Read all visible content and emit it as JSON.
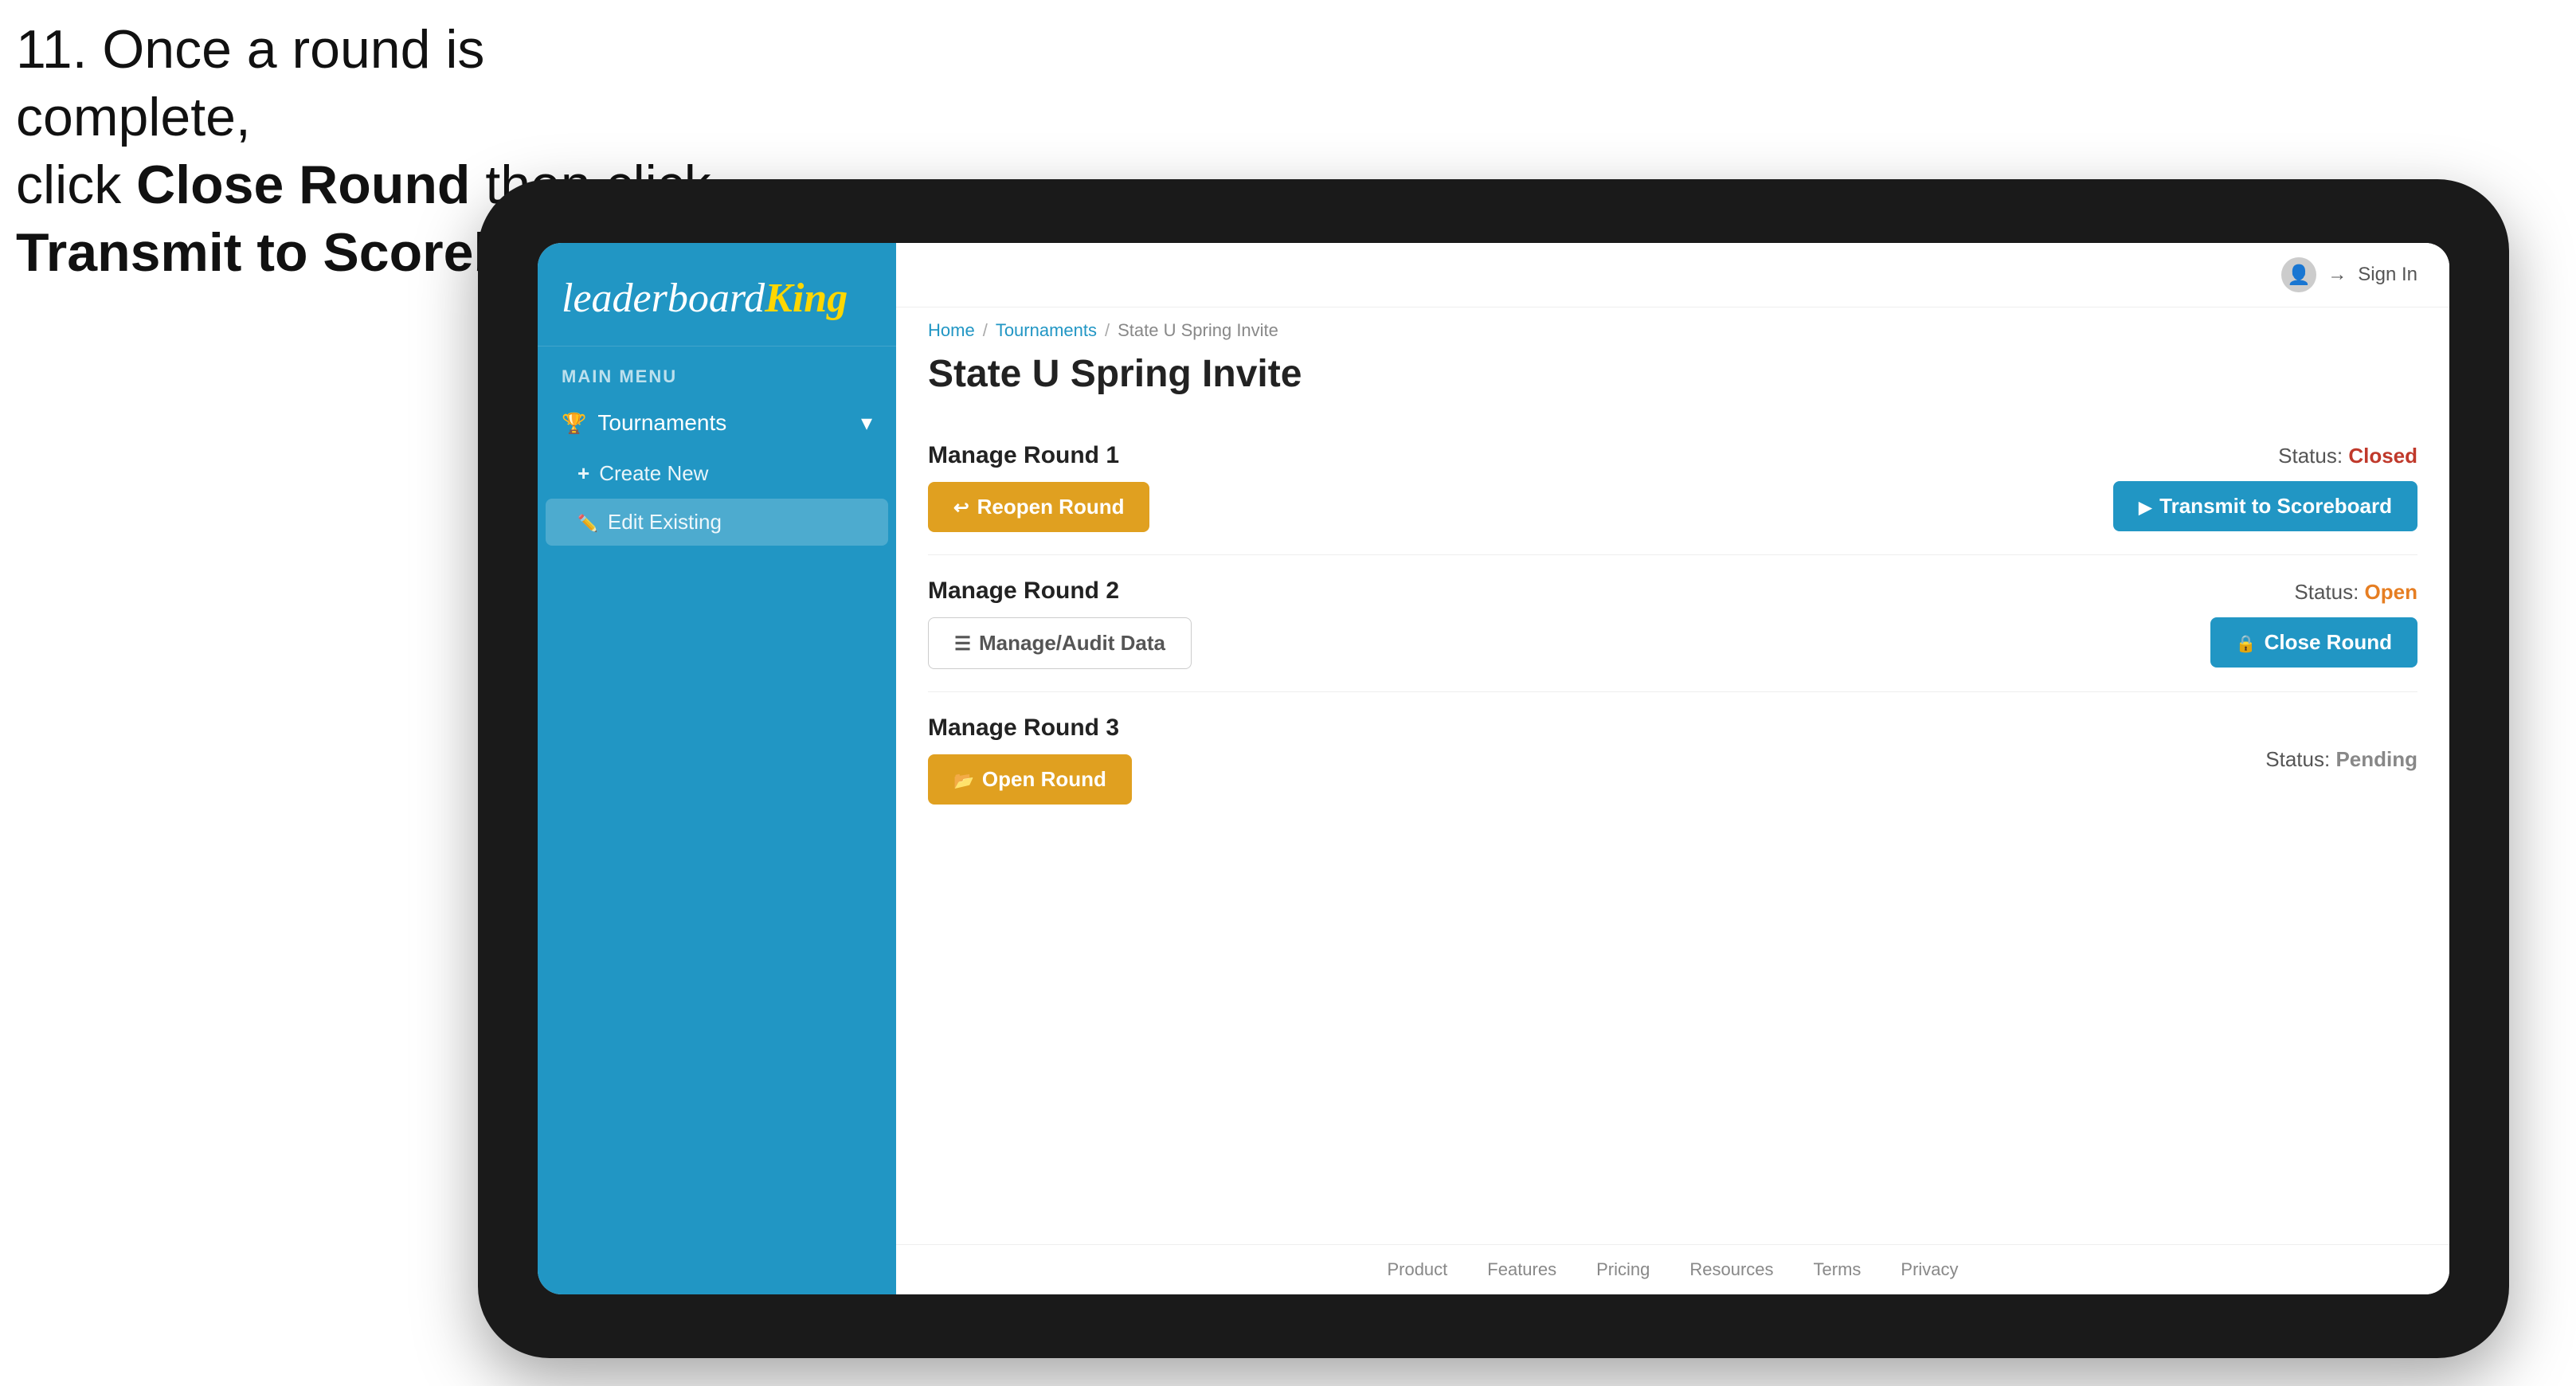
{
  "instruction": {
    "line1": "11. Once a round is complete,",
    "line2": "click ",
    "bold1": "Close Round",
    "line3": " then click",
    "line4_bold": "Transmit to Scoreboard."
  },
  "breadcrumb": {
    "home": "Home",
    "sep1": "/",
    "tournaments": "Tournaments",
    "sep2": "/",
    "current": "State U Spring Invite"
  },
  "page": {
    "title": "State U Spring Invite"
  },
  "topbar": {
    "sign_in": "Sign In"
  },
  "sidebar": {
    "logo": "leaderboard",
    "logo_king": "King",
    "menu_label": "MAIN MENU",
    "tournaments_label": "Tournaments",
    "create_new_label": "Create New",
    "edit_existing_label": "Edit Existing"
  },
  "rounds": [
    {
      "id": "round1",
      "title": "Manage Round 1",
      "status_label": "Status:",
      "status_value": "Closed",
      "status_type": "closed",
      "buttons": [
        {
          "id": "reopen",
          "label": "Reopen Round",
          "style": "gold",
          "icon": "reopen"
        }
      ],
      "right_buttons": [
        {
          "id": "transmit",
          "label": "Transmit to Scoreboard",
          "style": "blue",
          "icon": "transmit"
        }
      ]
    },
    {
      "id": "round2",
      "title": "Manage Round 2",
      "status_label": "Status:",
      "status_value": "Open",
      "status_type": "open",
      "buttons": [
        {
          "id": "manage-audit",
          "label": "Manage/Audit Data",
          "style": "outline",
          "icon": "audit"
        }
      ],
      "right_buttons": [
        {
          "id": "close",
          "label": "Close Round",
          "style": "blue",
          "icon": "close"
        }
      ]
    },
    {
      "id": "round3",
      "title": "Manage Round 3",
      "status_label": "Status:",
      "status_value": "Pending",
      "status_type": "pending",
      "buttons": [
        {
          "id": "open-round",
          "label": "Open Round",
          "style": "gold",
          "icon": "open"
        }
      ],
      "right_buttons": []
    }
  ],
  "footer": {
    "links": [
      "Product",
      "Features",
      "Pricing",
      "Resources",
      "Terms",
      "Privacy"
    ]
  }
}
